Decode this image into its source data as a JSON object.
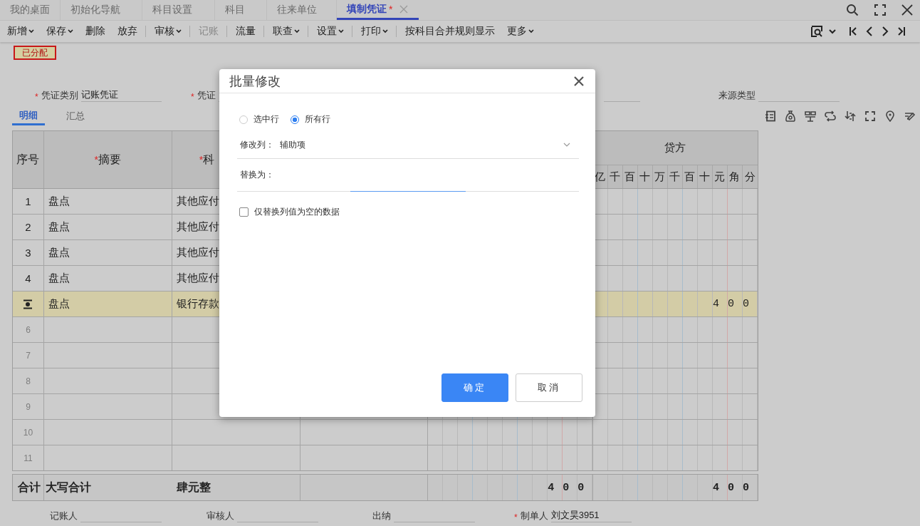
{
  "tabs": [
    {
      "label": "我的桌面",
      "selected": false,
      "closable": false
    },
    {
      "label": "初始化导航",
      "selected": false,
      "closable": false
    },
    {
      "label": "科目设置",
      "selected": false,
      "closable": false
    },
    {
      "label": "科目",
      "selected": false,
      "closable": false
    },
    {
      "label": "往来单位",
      "selected": false,
      "closable": false
    },
    {
      "label": "填制凭证",
      "mark": "*",
      "selected": true,
      "closable": true
    }
  ],
  "toolbar": [
    {
      "label": "新增",
      "dropdown": true,
      "disabled": false,
      "separator_before": false
    },
    {
      "label": "保存",
      "dropdown": true,
      "disabled": false,
      "separator_before": false
    },
    {
      "label": "删除",
      "dropdown": false,
      "disabled": false,
      "separator_before": false
    },
    {
      "label": "放弃",
      "dropdown": false,
      "disabled": false,
      "separator_before": false
    },
    {
      "label": "审核",
      "dropdown": true,
      "disabled": false,
      "separator_before": true
    },
    {
      "label": "记账",
      "dropdown": false,
      "disabled": true,
      "separator_before": true
    },
    {
      "label": "流量",
      "dropdown": false,
      "disabled": false,
      "separator_before": true
    },
    {
      "label": "联查",
      "dropdown": true,
      "disabled": false,
      "separator_before": true
    },
    {
      "label": "设置",
      "dropdown": true,
      "disabled": false,
      "separator_before": true
    },
    {
      "label": "打印",
      "dropdown": true,
      "disabled": false,
      "separator_before": true
    },
    {
      "label": "按科目合并规则显示",
      "dropdown": false,
      "disabled": false,
      "separator_before": true
    },
    {
      "label": "更多",
      "dropdown": true,
      "disabled": false,
      "separator_before": false
    }
  ],
  "status_badge": "已分配",
  "voucher_fields": [
    {
      "required_mark": "*",
      "label": "凭证类别",
      "value": "记账凭证"
    },
    {
      "required_mark": "*",
      "label": "凭证"
    },
    {
      "label": "来源类型"
    }
  ],
  "detail_tabs": [
    {
      "label": "明细",
      "selected": true
    },
    {
      "label": "汇总",
      "selected": false
    }
  ],
  "table": {
    "headers": {
      "number": "序号",
      "summary": {
        "mark": "*",
        "label": "摘要"
      },
      "account": {
        "mark": "*",
        "label": "科"
      },
      "credit": "贷方",
      "credit_units": [
        "亿",
        "千",
        "百",
        "十",
        "万",
        "千",
        "百",
        "十",
        "元",
        "角",
        "分"
      ]
    },
    "rows": [
      {
        "number": "1",
        "summary": "盘点",
        "account": "其他应付",
        "current": false,
        "empty": false
      },
      {
        "number": "2",
        "summary": "盘点",
        "account": "其他应付",
        "current": false,
        "empty": false
      },
      {
        "number": "3",
        "summary": "盘点",
        "account": "其他应付",
        "current": false,
        "empty": false
      },
      {
        "number": "4",
        "summary": "盘点",
        "account": "其他应付",
        "current": false,
        "empty": false
      },
      {
        "summary": "盘点",
        "account": "银行存款",
        "credit": "400",
        "current": true,
        "empty": false
      },
      {
        "number": "6",
        "current": false,
        "empty": true
      },
      {
        "number": "7",
        "current": false,
        "empty": true
      },
      {
        "number": "8",
        "current": false,
        "empty": true
      },
      {
        "number": "9",
        "current": false,
        "empty": true
      },
      {
        "number": "10",
        "current": false,
        "empty": true
      },
      {
        "number": "11",
        "current": false,
        "empty": true
      }
    ],
    "total": {
      "label": "合计",
      "caption": "大写合计",
      "amount_words": "肆元整",
      "debit": "400",
      "credit": "400"
    }
  },
  "footer": [
    {
      "label": "记账人"
    },
    {
      "label": "审核人"
    },
    {
      "label": "出纳"
    },
    {
      "required_mark": "*",
      "label": "制单人",
      "value": "刘文昊3951"
    }
  ],
  "dialog": {
    "title": "批量修改",
    "scope_options": [
      {
        "label": "选中行",
        "selected": false
      },
      {
        "label": "所有行",
        "selected": true
      }
    ],
    "column_field": {
      "label": "修改列：",
      "value": "辅助项"
    },
    "replace_field": {
      "label": "替换为：",
      "focused": true
    },
    "only_empty": {
      "label": "仅替换列值为空的数据",
      "checked": false
    },
    "buttons": [
      {
        "label": "确定",
        "kind": "primary"
      },
      {
        "label": "取消",
        "kind": "default"
      }
    ]
  }
}
